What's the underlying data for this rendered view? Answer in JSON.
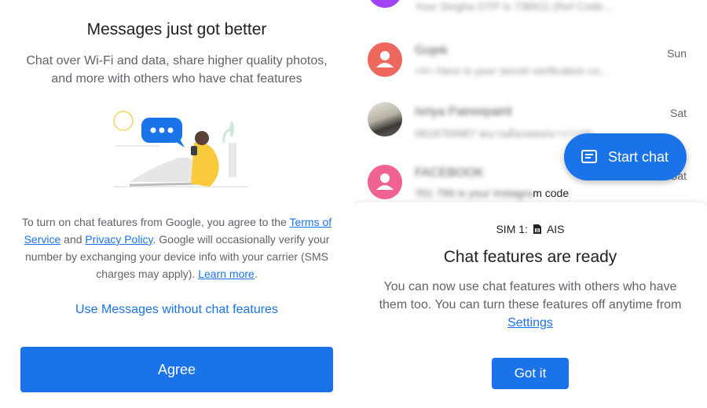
{
  "left": {
    "title": "Messages just got better",
    "subtitle": "Chat over Wi-Fi and data, share higher quality photos, and more with others who have chat features",
    "legal_1": "To turn on chat features from Google, you agree to the ",
    "terms_link": "Terms of Service",
    "legal_and": " and ",
    "privacy_link": "Privacy Policy",
    "legal_2": ". Google will occasionally verify your number by exchanging your device info with your carrier (SMS charges may apply). ",
    "learn_more_link": "Learn more",
    "legal_end": ".",
    "no_chat_label": "Use Messages without chat features",
    "agree_label": "Agree"
  },
  "conversations": [
    {
      "name": "",
      "snippet": "Your Singha OTP is 738911 (Ref Code...",
      "time": "",
      "avatar": "purple"
    },
    {
      "name": "Gojek",
      "snippet": "<#> Here is your secret verification co...",
      "time": "Sun",
      "avatar": "red"
    },
    {
      "name": "Isriya Paireepairit",
      "snippet": "0818769987 พนานต้องอดอนาวาว15:",
      "time": "Sat",
      "avatar": "photo"
    },
    {
      "name": "FACEBOOK",
      "snippet_blur": "701 799 is your Instagra",
      "snippet_clear": "m code",
      "time": "Sat",
      "avatar": "pink"
    }
  ],
  "fab": {
    "label": "Start chat",
    "icon": "chat-icon"
  },
  "sheet": {
    "sim_label": "SIM 1:",
    "carrier": "AIS",
    "title": "Chat features are ready",
    "body": "You can now use chat features with others who have them too. You can turn these features off anytime from ",
    "settings_link": "Settings",
    "gotit_label": "Got it"
  },
  "colors": {
    "accent": "#1a73e8",
    "avatar_red": "#ee675c",
    "avatar_pink": "#f06292",
    "avatar_purple": "#a142f4"
  }
}
